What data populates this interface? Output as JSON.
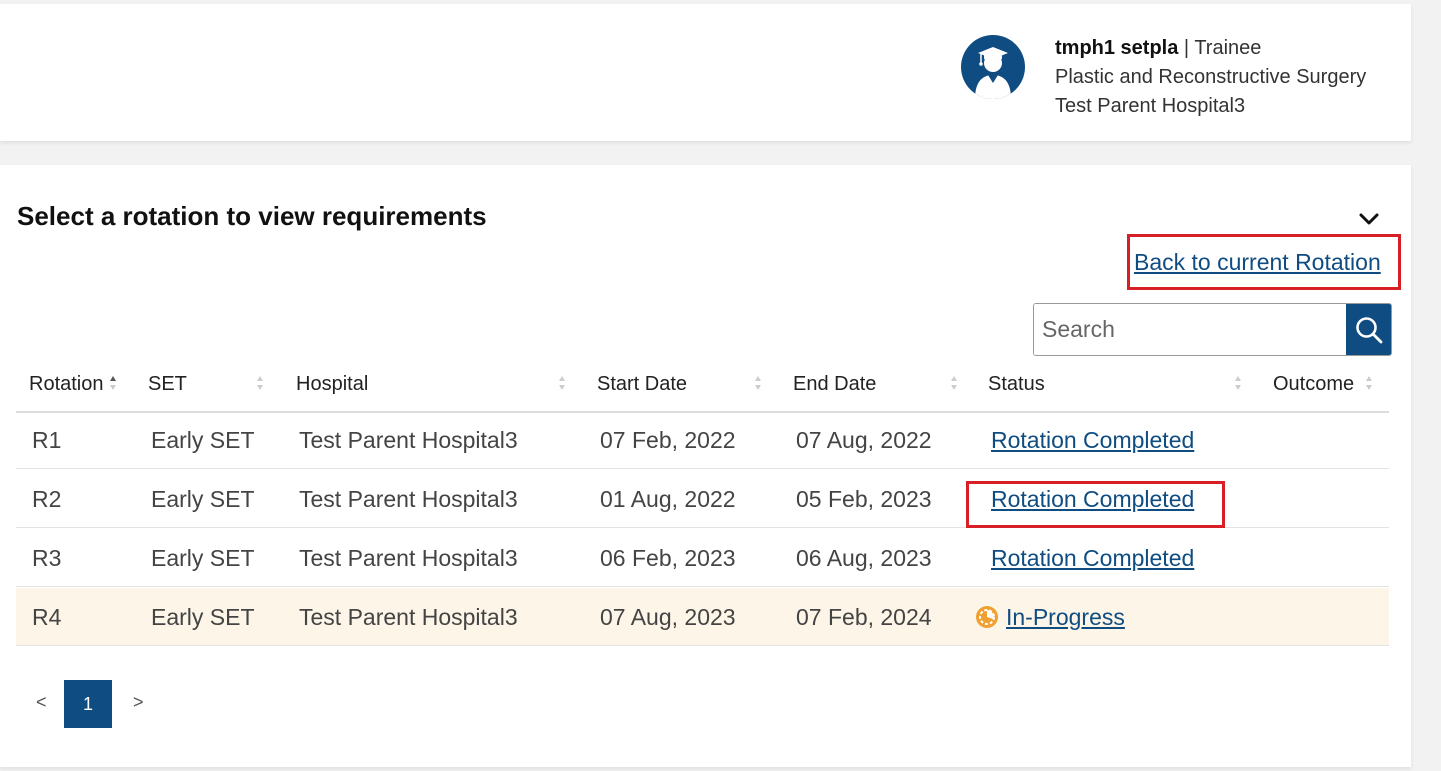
{
  "user": {
    "name": "tmph1 setpla",
    "separator": "|",
    "role": "Trainee",
    "specialty": "Plastic and Reconstructive Surgery",
    "hospital": "Test Parent Hospital3"
  },
  "section": {
    "title": "Select a rotation to view requirements",
    "back_link": "Back to current Rotation"
  },
  "search": {
    "placeholder": "Search",
    "value": ""
  },
  "table": {
    "columns": [
      "Rotation",
      "SET",
      "Hospital",
      "Start Date",
      "End Date",
      "Status",
      "Outcome"
    ],
    "rows": [
      {
        "rotation": "R1",
        "set": "Early SET",
        "hospital": "Test Parent Hospital3",
        "start": "07 Feb, 2022",
        "end": "07 Aug, 2022",
        "status": "Rotation Completed",
        "outcome": ""
      },
      {
        "rotation": "R2",
        "set": "Early SET",
        "hospital": "Test Parent Hospital3",
        "start": "01 Aug, 2022",
        "end": "05 Feb, 2023",
        "status": "Rotation Completed",
        "outcome": ""
      },
      {
        "rotation": "R3",
        "set": "Early SET",
        "hospital": "Test Parent Hospital3",
        "start": "06 Feb, 2023",
        "end": "06 Aug, 2023",
        "status": "Rotation Completed",
        "outcome": ""
      },
      {
        "rotation": "R4",
        "set": "Early SET",
        "hospital": "Test Parent Hospital3",
        "start": "07 Aug, 2023",
        "end": "07 Feb, 2024",
        "status": "In-Progress",
        "outcome": ""
      }
    ]
  },
  "pagination": {
    "prev": "<",
    "current": "1",
    "next": ">"
  },
  "colors": {
    "brand": "#0f4c81",
    "highlight": "#d61f26",
    "current_row": "#fdf6e8",
    "progress": "#f0a030"
  },
  "icons": {
    "avatar": "graduate-icon",
    "chevron": "chevron-down-icon",
    "search": "search-icon",
    "progress": "in-progress-icon"
  }
}
